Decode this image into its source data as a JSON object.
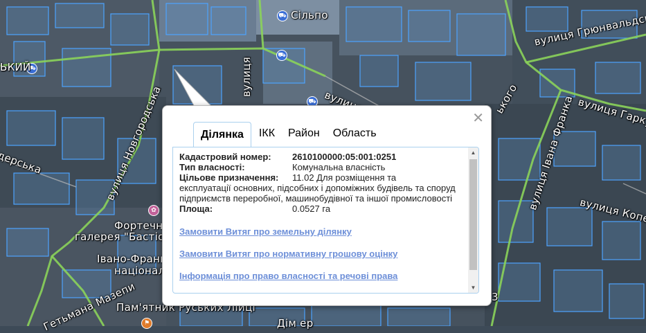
{
  "map": {
    "labels": {
      "silpo": "Сільпо",
      "vul_hrunvaldska": "вулиця Грюнвальдська",
      "vul_left": "вулиця",
      "vul_arkas": "вулиця",
      "vul_lower": "вулиця",
      "vul_hark": "вулиця Гарку",
      "vul_novgorodska": "вулиця Новгородська",
      "vul_ivana_franka": "вулиця Івана Франка",
      "vul_koper": "вулиця Копер",
      "kyi_frag": "ЬКИЙ",
      "derska": "дерська",
      "fortechna": "Фортечна",
      "galereya": "галерея \"Бастіон\"",
      "ivano_frank": "Івано-Франк",
      "natsional": "націонал",
      "hetmana": "Гетьмана Мазепи",
      "pamyatnyk": "Пам'ятник Руських Ліиці",
      "skogo": "ького",
      "b3": "3",
      "dom": "Дім ер"
    }
  },
  "popup": {
    "tabs": [
      {
        "label": "Ділянка",
        "active": true
      },
      {
        "label": "ІКК",
        "active": false
      },
      {
        "label": "Район",
        "active": false
      },
      {
        "label": "Область",
        "active": false
      }
    ],
    "cadastral_label": "Кадастровий номер:",
    "cadastral_value": "2610100000:05:001:0251",
    "ownership_label": "Тип власності:",
    "ownership_value": "Комунальна власність",
    "purpose_label": "Цільове призначення:",
    "purpose_value_first": "11.02 Для розміщення та",
    "purpose_value_rest": "експлуатації основних, підсобних і допоміжних будівель та споруд підприємств переробної, машинобудівної та іншої промисловості",
    "area_label": "Площа:",
    "area_value": "0.0527 га",
    "links": [
      "Замовити Витяг про земельну ділянку",
      "Замовити Витяг про нормативну грошову оцінку",
      "Інформація про право власності та речові права"
    ],
    "close_glyph": "✕"
  }
}
